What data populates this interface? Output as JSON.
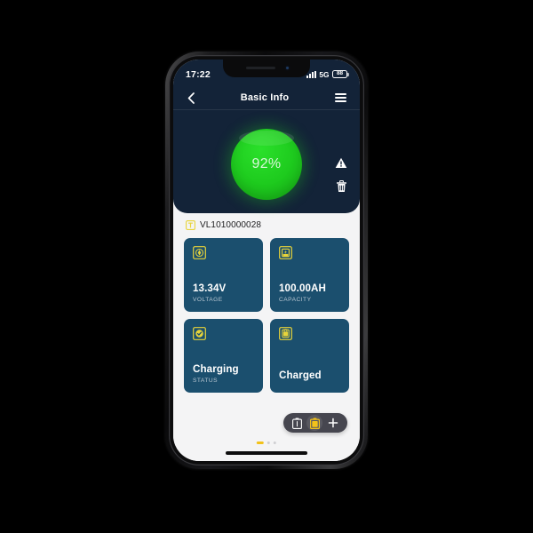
{
  "status_bar": {
    "time": "17:22",
    "network": "5G",
    "battery_level": "88",
    "signal_icon": "signal-bars-icon",
    "battery_icon": "battery-icon"
  },
  "nav_bar": {
    "back_icon": "chevron-left-icon",
    "title": "Basic Info",
    "menu_icon": "hamburger-menu-icon"
  },
  "battery_ring": {
    "percent": "92%",
    "color": "#1ecb1e",
    "text_color": "#d8f8d8"
  },
  "side_actions": [
    {
      "name": "warning-icon",
      "label": "Warning"
    },
    {
      "name": "trash-icon",
      "label": "Delete"
    }
  ],
  "serial": {
    "icon": "tag-icon",
    "value": "VL1010000028"
  },
  "cards": [
    {
      "icon": "voltage-icon",
      "value": "13.34V",
      "label": "VOLTAGE"
    },
    {
      "icon": "capacity-icon",
      "value": "100.00AH",
      "label": "CAPACITY"
    },
    {
      "icon": "charging-check-icon",
      "value": "Charging",
      "label": "STATUS"
    },
    {
      "icon": "charged-lock-icon",
      "value": "Charged",
      "label": ""
    }
  ],
  "bottom_nav": {
    "items": [
      {
        "name": "nav-battery-list-icon",
        "active": false
      },
      {
        "name": "nav-battery-active-icon",
        "active": true
      },
      {
        "name": "nav-add-icon",
        "active": false
      }
    ],
    "accent_color": "#f2c21a",
    "background": "#46464f"
  },
  "page_dots": {
    "count": 3,
    "active_index": 0,
    "active_color": "#f2c21a"
  },
  "theme": {
    "header_bg": "#132338",
    "content_bg": "#f4f4f5",
    "card_bg": "#1b4f6e",
    "icon_accent": "#e8d43a"
  }
}
